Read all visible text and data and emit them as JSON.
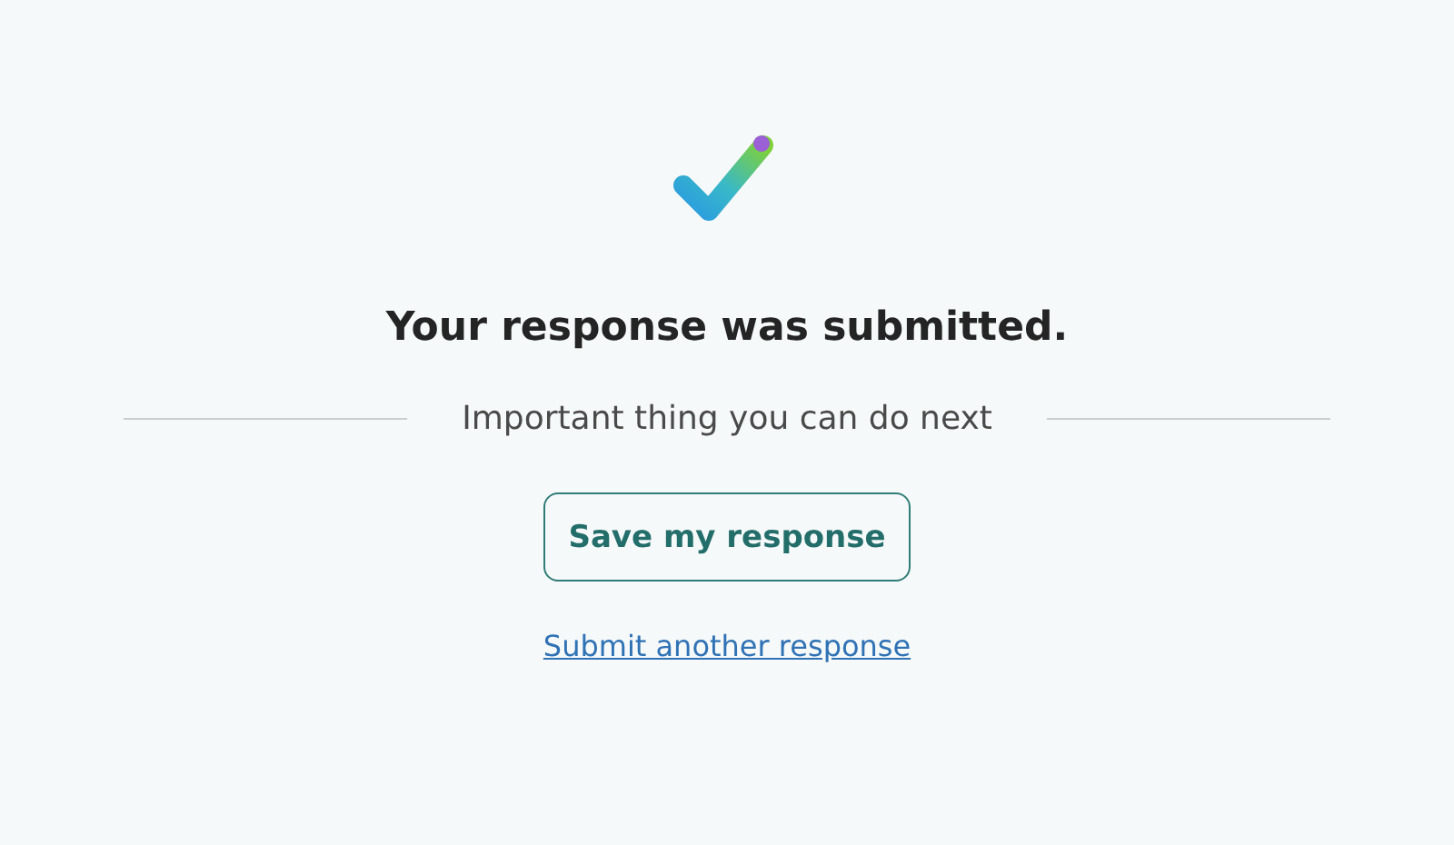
{
  "title": "Your response was submitted.",
  "next_heading": "Important thing you can do next",
  "save_button": "Save my response",
  "another_link": "Submit another response"
}
